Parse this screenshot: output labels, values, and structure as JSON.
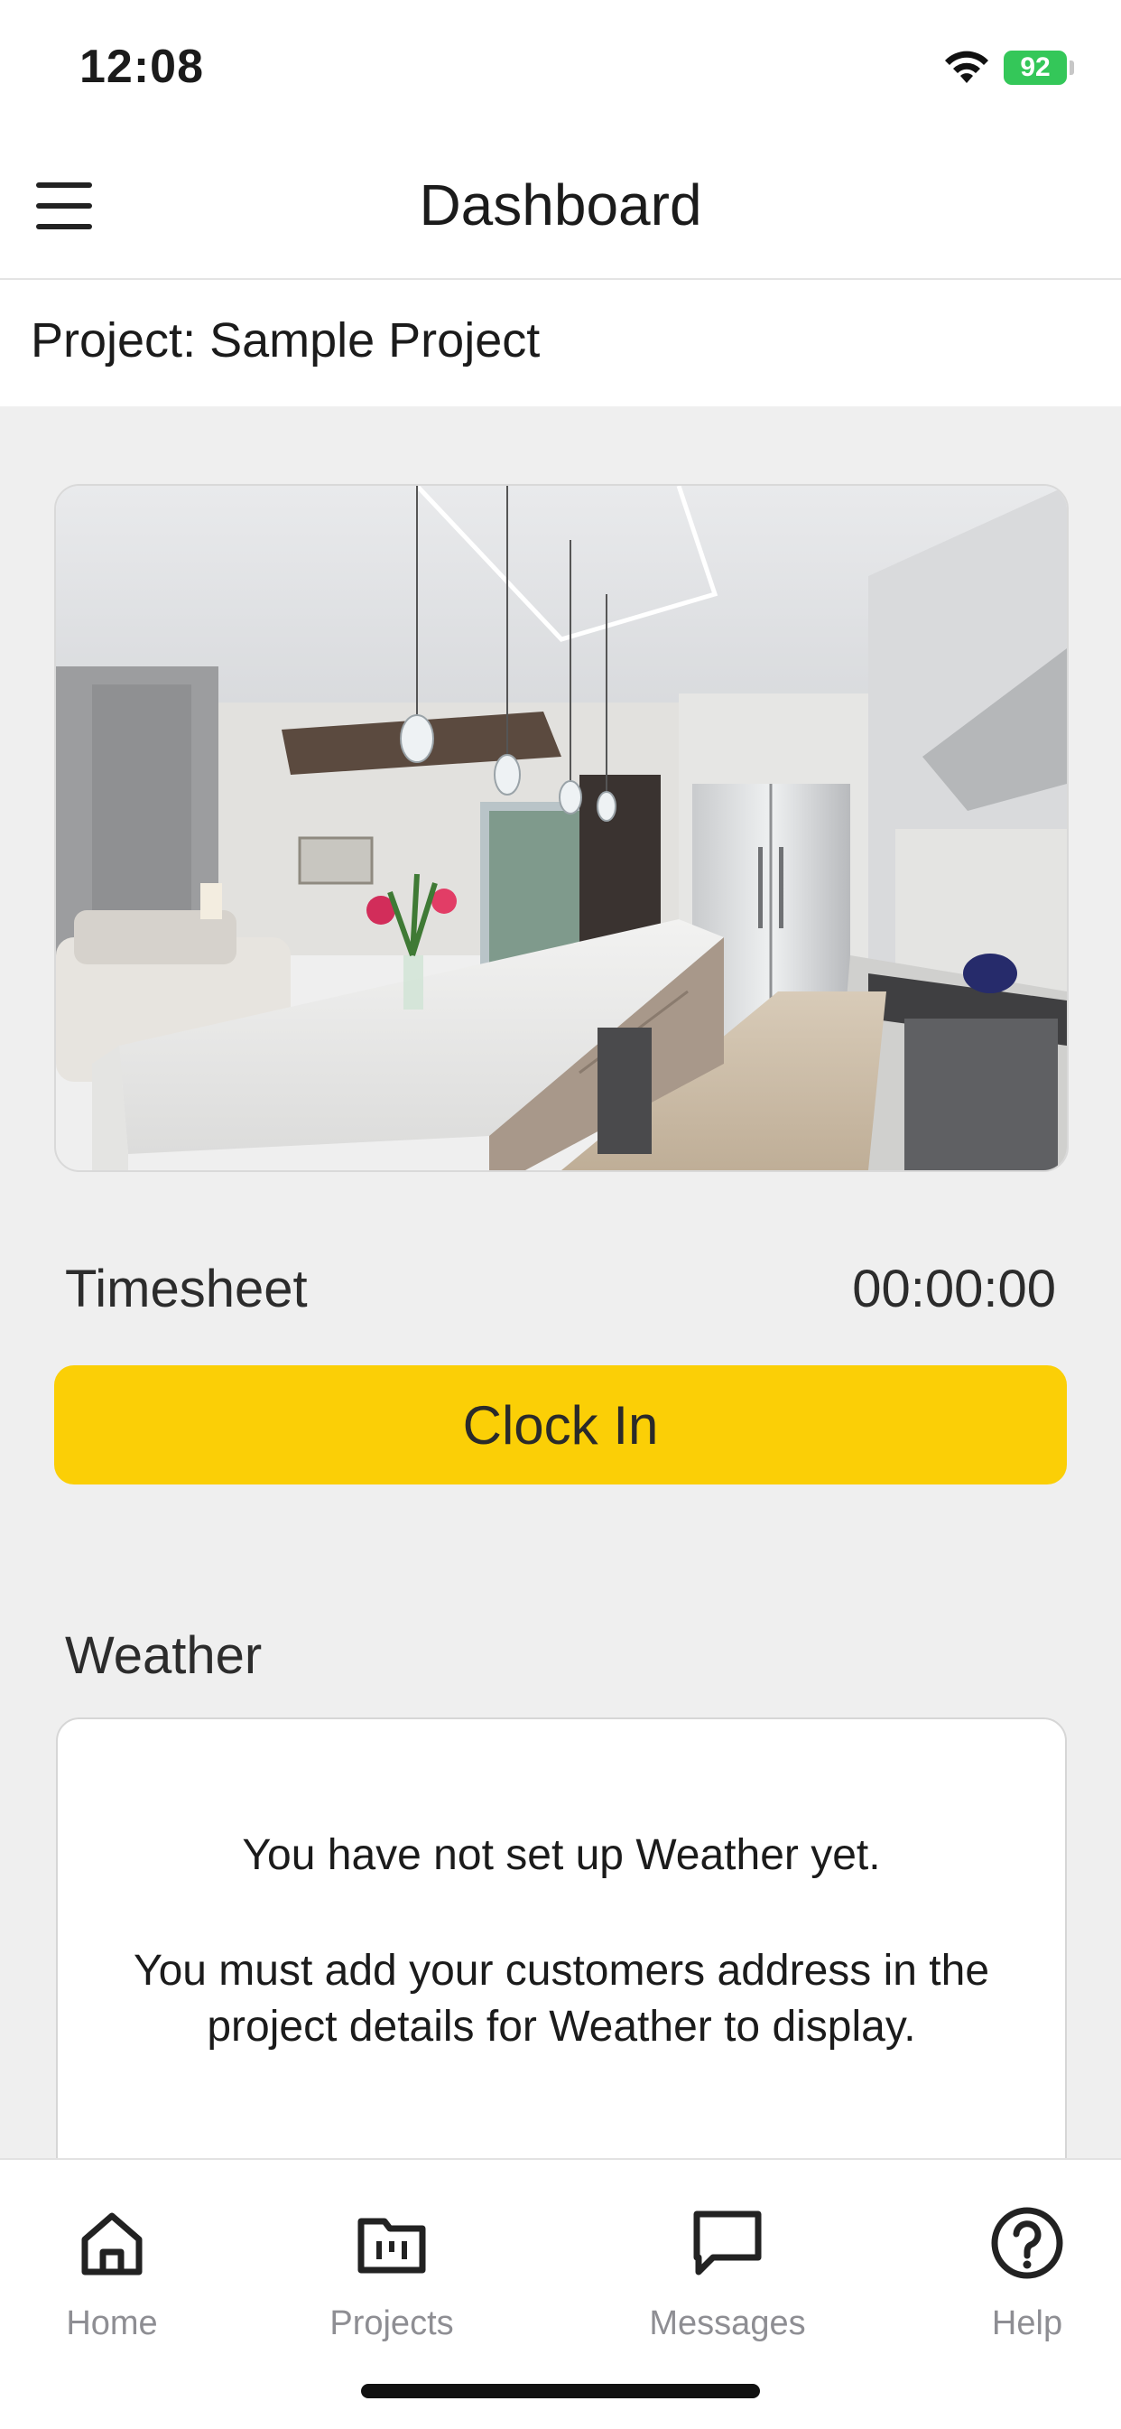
{
  "status_bar": {
    "time": "12:08",
    "battery": "92"
  },
  "nav": {
    "title": "Dashboard"
  },
  "project": {
    "label": "Project: Sample Project"
  },
  "timesheet": {
    "label": "Timesheet",
    "value": "00:00:00",
    "clock_button": "Clock In"
  },
  "weather": {
    "label": "Weather",
    "message_line1": "You have not set up Weather yet.",
    "message_line2": "You must add your customers address in the project details for Weather to display."
  },
  "tabs": [
    {
      "label": "Home",
      "icon": "home-icon"
    },
    {
      "label": "Projects",
      "icon": "projects-folder-icon"
    },
    {
      "label": "Messages",
      "icon": "messages-icon"
    },
    {
      "label": "Help",
      "icon": "help-icon"
    }
  ],
  "colors": {
    "accent": "#fbcf06",
    "battery": "#34c759",
    "tab_inactive": "#8e8e93"
  }
}
